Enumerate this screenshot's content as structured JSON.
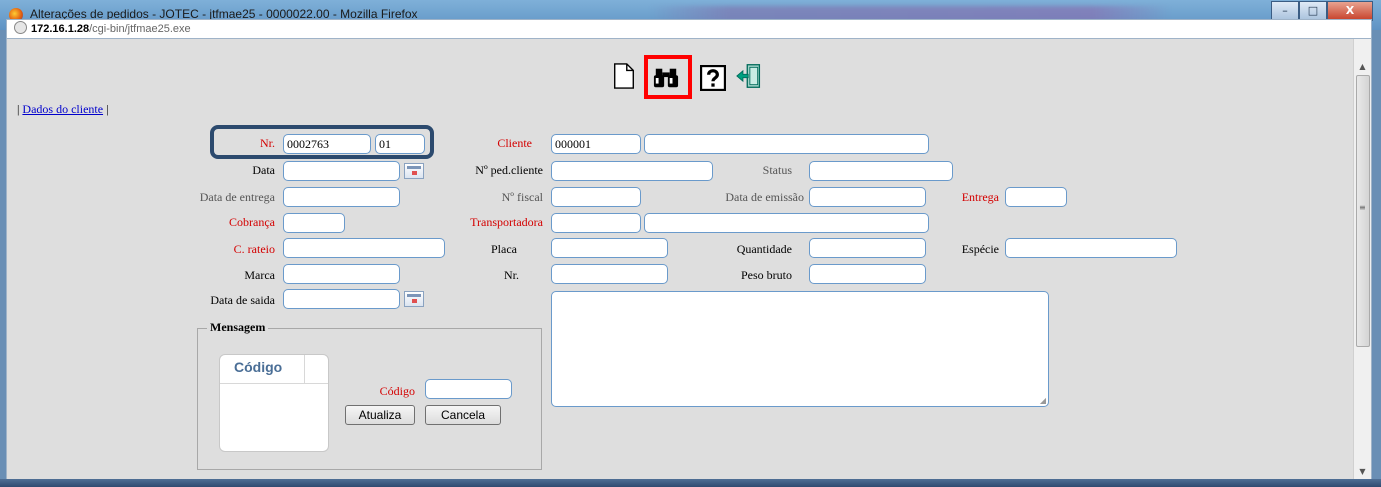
{
  "window": {
    "title": "Alterações de pedidos - JOTEC - jtfmae25 - 0000022.00 - Mozilla Firefox",
    "minimize": "–",
    "maximize": "□",
    "close": "X"
  },
  "address": {
    "host": "172.16.1.28",
    "path": "/cgi-bin/jtfmae25.exe"
  },
  "toolbar": {
    "icons": [
      "new-document-icon",
      "binoculars-search-icon",
      "help-icon",
      "exit-door-icon"
    ],
    "highlighted": "binoculars-search-icon",
    "highlight_color": "#ff0000"
  },
  "nav": {
    "sep_left": "|",
    "link": "Dados do cliente",
    "sep_right": "|"
  },
  "form": {
    "nr": {
      "label": "Nr.",
      "value": "0002763",
      "seq": "01"
    },
    "cliente": {
      "label": "Cliente",
      "code": "000001",
      "name": ""
    },
    "data": {
      "label": "Data",
      "value": ""
    },
    "ped_cliente": {
      "label": "Nº ped.cliente",
      "value": ""
    },
    "status": {
      "label": "Status",
      "value": ""
    },
    "data_entrega": {
      "label": "Data de entrega",
      "value": ""
    },
    "n_fiscal": {
      "label": "Nº fiscal",
      "value": ""
    },
    "data_emissao": {
      "label": "Data de emissão",
      "value": ""
    },
    "entrega": {
      "label": "Entrega",
      "value": ""
    },
    "cobranca": {
      "label": "Cobrança",
      "value": ""
    },
    "transportadora": {
      "label": "Transportadora",
      "code": "",
      "name": ""
    },
    "c_rateio": {
      "label": "C. rateio",
      "value": ""
    },
    "placa": {
      "label": "Placa",
      "value": ""
    },
    "quantidade": {
      "label": "Quantidade",
      "value": ""
    },
    "especie": {
      "label": "Espécie",
      "value": ""
    },
    "marca": {
      "label": "Marca",
      "value": ""
    },
    "nr2": {
      "label": "Nr.",
      "value": ""
    },
    "peso_bruto": {
      "label": "Peso bruto",
      "value": ""
    },
    "data_saida": {
      "label": "Data de saida",
      "value": ""
    },
    "observacao": ""
  },
  "mensagem": {
    "legend": "Mensagem",
    "grid_header": "Código",
    "codigo_label": "Código",
    "codigo_value": "",
    "atualiza": "Atualiza",
    "cancela": "Cancela"
  },
  "colors": {
    "required_label": "#d40000",
    "nr_outline": "#2c4a6e",
    "field_border": "#6a9acb"
  }
}
